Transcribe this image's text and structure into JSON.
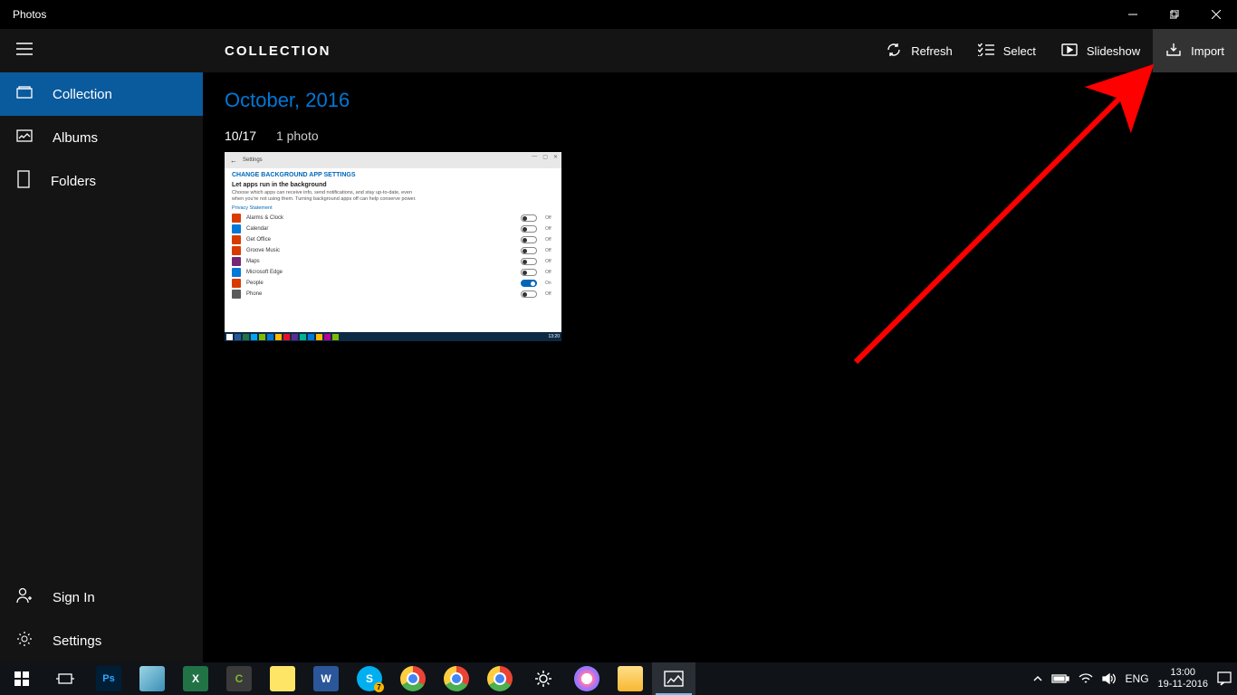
{
  "window": {
    "title": "Photos"
  },
  "toolbar": {
    "page_title": "COLLECTION",
    "refresh": "Refresh",
    "select": "Select",
    "slideshow": "Slideshow",
    "import": "Import"
  },
  "sidebar": {
    "collection": "Collection",
    "albums": "Albums",
    "folders": "Folders",
    "signin": "Sign In",
    "settings": "Settings"
  },
  "content": {
    "month_heading": "October, 2016",
    "day_date": "10/17",
    "day_count": "1 photo"
  },
  "thumbnail": {
    "breadcrumb": "Settings",
    "heading": "CHANGE BACKGROUND APP SETTINGS",
    "subheading": "Let apps run in the background",
    "desc": "Choose which apps can receive info, send notifications, and stay up-to-date, even when you're not using them. Turning background apps off can help conserve power.",
    "privacy": "Privacy Statement",
    "rows": [
      {
        "label": "Alarms & Clock",
        "color": "#d83b01",
        "on": false
      },
      {
        "label": "Calendar",
        "color": "#0078d7",
        "on": false
      },
      {
        "label": "Get Office",
        "color": "#d83b01",
        "on": false
      },
      {
        "label": "Groove Music",
        "color": "#d83b01",
        "on": false
      },
      {
        "label": "Maps",
        "color": "#742774",
        "on": false
      },
      {
        "label": "Microsoft Edge",
        "color": "#0078d7",
        "on": false
      },
      {
        "label": "People",
        "color": "#d83b01",
        "on": true
      },
      {
        "label": "Phone",
        "color": "#5a5a5a",
        "on": false
      }
    ],
    "state_on": "On",
    "state_off": "Off"
  },
  "systray": {
    "lang": "ENG",
    "time": "13:00",
    "date": "19-11-2016",
    "badge": "7"
  }
}
